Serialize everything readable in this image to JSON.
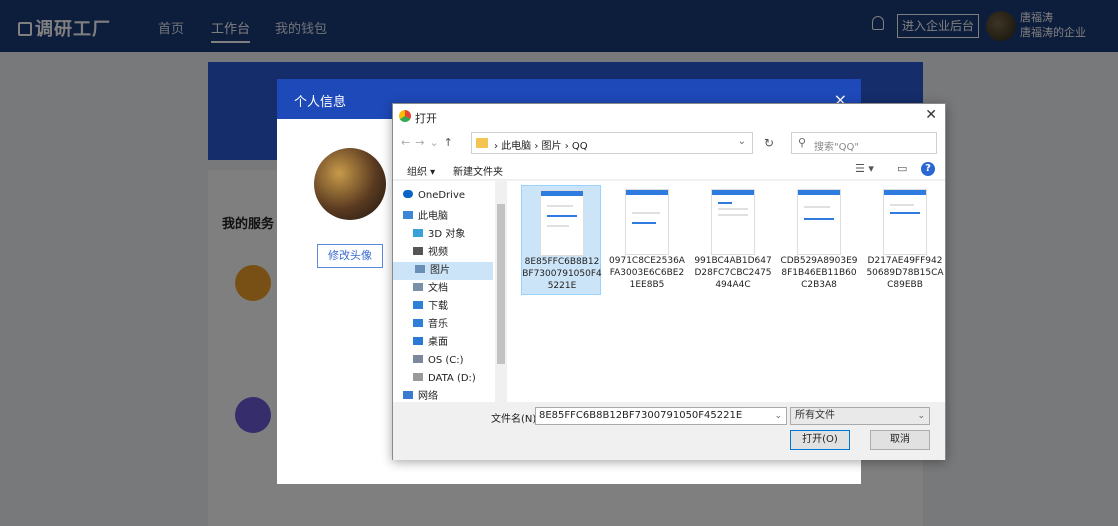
{
  "nav": {
    "logo": "调研工厂",
    "links": [
      "首页",
      "工作台",
      "我的钱包"
    ],
    "enter_btn": "进入企业后台",
    "user_name": "唐福涛",
    "user_org": "唐福涛的企业"
  },
  "page": {
    "services_title": "我的服务"
  },
  "modal": {
    "title": "个人信息",
    "close": "×",
    "edit_avatar": "修改头像"
  },
  "dialog": {
    "title": "打开",
    "close": "✕",
    "path": [
      "此电脑",
      "图片",
      "QQ"
    ],
    "search_placeholder": "搜索\"QQ\"",
    "toolbar": {
      "organize": "组织 ▾",
      "new_folder": "新建文件夹"
    },
    "sidebar": [
      {
        "label": "OneDrive",
        "icon": "cloud-icon",
        "color": "#0a64c8"
      },
      {
        "label": "此电脑",
        "icon": "computer-icon",
        "color": "#3b86d6"
      },
      {
        "label": "3D 对象",
        "icon": "cube-icon",
        "color": "#3aa0d8"
      },
      {
        "label": "视频",
        "icon": "video-icon",
        "color": "#555555"
      },
      {
        "label": "图片",
        "icon": "picture-icon",
        "color": "#6a8fb5"
      },
      {
        "label": "文档",
        "icon": "document-icon",
        "color": "#7a8fa8"
      },
      {
        "label": "下载",
        "icon": "download-icon",
        "color": "#2f7fd6"
      },
      {
        "label": "音乐",
        "icon": "music-icon",
        "color": "#2f7fd6"
      },
      {
        "label": "桌面",
        "icon": "desktop-icon",
        "color": "#2a7ad4"
      },
      {
        "label": "OS (C:)",
        "icon": "drive-icon",
        "color": "#7a8a9a"
      },
      {
        "label": "DATA (D:)",
        "icon": "drive-icon",
        "color": "#9a9a9a"
      },
      {
        "label": "网络",
        "icon": "network-icon",
        "color": "#3a7ad0"
      }
    ],
    "files": [
      {
        "name": "8E85FFC6B8B12BF7300791050F45221E"
      },
      {
        "name": "0971C8CE2536AFA3003E6C6BE21EE8B5"
      },
      {
        "name": "991BC4AB1D647D28FC7CBC2475494A4C"
      },
      {
        "name": "CDB529A8903E98F1B46EB11B60C2B3A8"
      },
      {
        "name": "D217AE49FF94250689D78B15CAC89EBB"
      }
    ],
    "filename_label": "文件名(N):",
    "filename_value": "8E85FFC6B8B12BF7300791050F45221E",
    "filetype": "所有文件",
    "open_btn": "打开(O)",
    "cancel_btn": "取消"
  }
}
